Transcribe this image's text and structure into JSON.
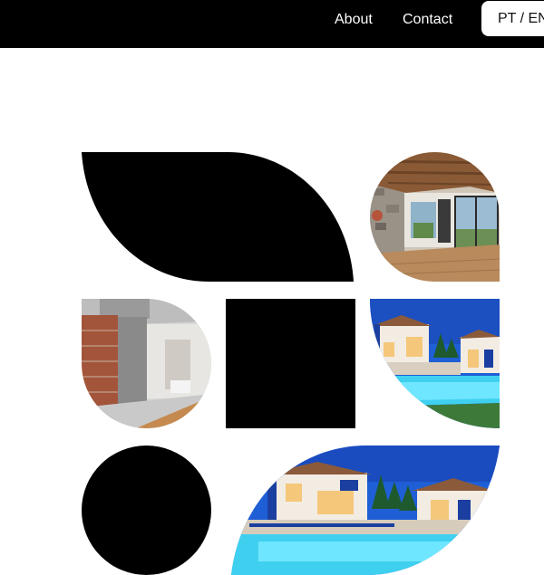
{
  "header": {
    "nav": [
      {
        "label": "About"
      },
      {
        "label": "Contact"
      }
    ],
    "language_button": "PT / EN"
  },
  "gallery": {
    "tiles": [
      {
        "kind": "shape",
        "shape": "leaf"
      },
      {
        "kind": "photo",
        "subject": "bright living room with wooden floor and stone wall"
      },
      {
        "kind": "photo",
        "subject": "interior under renovation with exposed brick wall"
      },
      {
        "kind": "shape",
        "shape": "square"
      },
      {
        "kind": "photo",
        "subject": "villa with illuminated pool at dusk"
      },
      {
        "kind": "shape",
        "shape": "circle"
      },
      {
        "kind": "photo",
        "subject": "villa with illuminated pool at dusk"
      }
    ]
  },
  "colors": {
    "header_bg": "#000000",
    "page_bg": "#ffffff",
    "shape_fill": "#000000",
    "accent_blue": "#1f5fd6"
  }
}
